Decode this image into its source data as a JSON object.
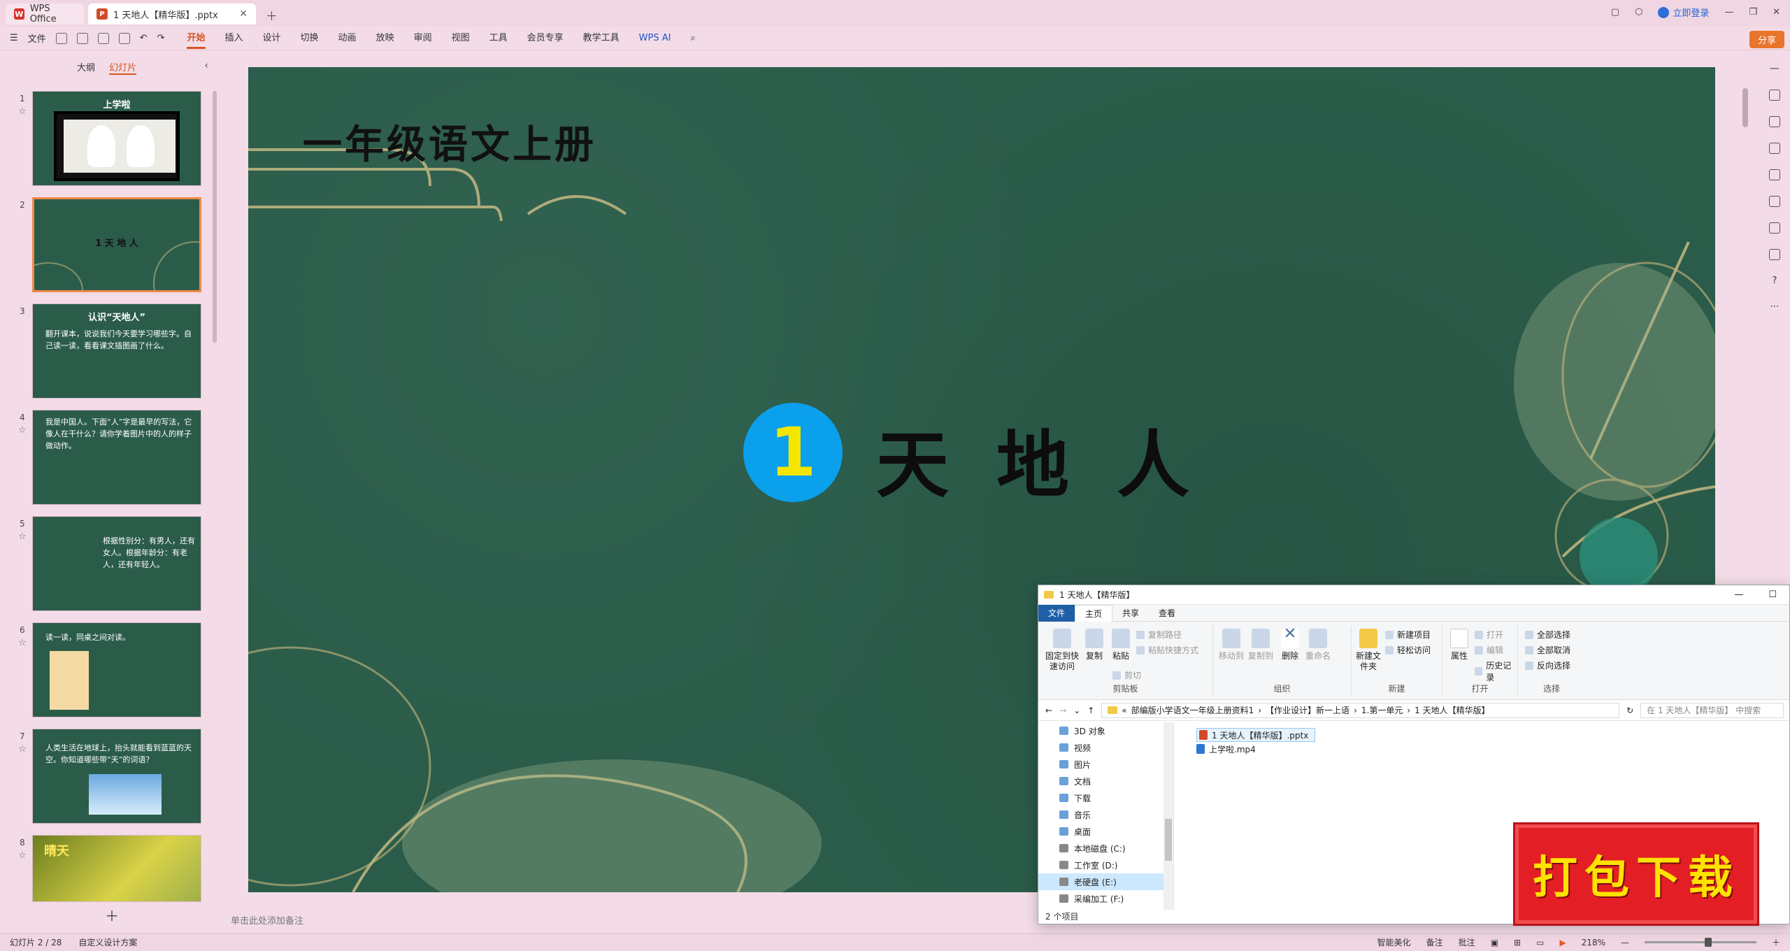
{
  "window": {
    "home_tab": "WPS Office",
    "doc_tab": "1 天地人【精华版】.pptx",
    "login": "立即登录",
    "share": "分享"
  },
  "menu": {
    "file": "文件",
    "tabs": [
      "开始",
      "插入",
      "设计",
      "切换",
      "动画",
      "放映",
      "审阅",
      "视图",
      "工具",
      "会员专享",
      "教学工具"
    ],
    "active_tab": "开始",
    "wps_ai": "WPS AI"
  },
  "left_panel": {
    "tab_outline": "大纲",
    "tab_slides": "幻灯片",
    "thumbs": [
      {
        "num": "1",
        "title": "上学啦",
        "text": ""
      },
      {
        "num": "2",
        "title": "1 天 地 人",
        "text": ""
      },
      {
        "num": "3",
        "title": "认识“天地人”",
        "text": "翻开课本，说说我们今天要学习哪些字。自己读一读，看看课文插图画了什么。"
      },
      {
        "num": "4",
        "title": "",
        "text": "我是中国人。下面“人”字是最早的写法，它像人在干什么？请你学着图片中的人的样子做动作。"
      },
      {
        "num": "5",
        "title": "",
        "text": "根据性别分：有男人，还有女人。根据年龄分：有老人，还有年轻人。"
      },
      {
        "num": "6",
        "title": "",
        "text": "读一读，同桌之间对读。"
      },
      {
        "num": "7",
        "title": "",
        "text": "人类生活在地球上，抬头就能看到蓝蓝的天空。你知道哪些带“天”的词语？"
      },
      {
        "num": "8",
        "title": "晴天",
        "text": ""
      }
    ]
  },
  "slide": {
    "title": "一年级语文上册",
    "number": "1",
    "lesson": "天地人",
    "notes_placeholder": "单击此处添加备注"
  },
  "status": {
    "slide_info": "幻灯片 2 / 28",
    "design": "自定义设计方案",
    "beautify": "智能美化",
    "notes": "备注",
    "comments": "批注",
    "zoom": "218%"
  },
  "explorer": {
    "title": "1 天地人【精华版】",
    "tabs": [
      "文件",
      "主页",
      "共享",
      "查看"
    ],
    "groups": {
      "clipboard": "剪贴板",
      "organize": "组织",
      "new": "新建",
      "open": "打开",
      "select": "选择"
    },
    "buttons": {
      "pin": "固定到快速访问",
      "copy": "复制",
      "paste": "粘贴",
      "copy_path": "复制路径",
      "paste_shortcut": "粘贴快捷方式",
      "cut": "剪切",
      "move_to": "移动到",
      "copy_to": "复制到",
      "delete": "删除",
      "rename": "重命名",
      "new_folder": "新建文件夹",
      "new_item": "新建项目",
      "easy_access": "轻松访问",
      "properties": "属性",
      "open": "打开",
      "edit": "编辑",
      "history": "历史记录",
      "select_all": "全部选择",
      "select_none": "全部取消",
      "invert": "反向选择"
    },
    "path": [
      "部编版小学语文一年级上册资料1",
      "【作业设计】新一上语",
      "1.第一单元",
      "1 天地人【精华版】"
    ],
    "search_placeholder": "在 1 天地人【精华版】 中搜索",
    "nav": [
      "3D 对象",
      "视频",
      "图片",
      "文档",
      "下载",
      "音乐",
      "桌面",
      "本地磁盘 (C:)",
      "工作室 (D:)",
      "老硬盘 (E:)",
      "采编加工 (F:)"
    ],
    "nav_selected": "老硬盘 (E:)",
    "files": [
      "1 天地人【精华版】.pptx",
      "上学啦.mp4"
    ],
    "count": "2 个项目"
  },
  "stamp": {
    "text": "打包下载"
  }
}
